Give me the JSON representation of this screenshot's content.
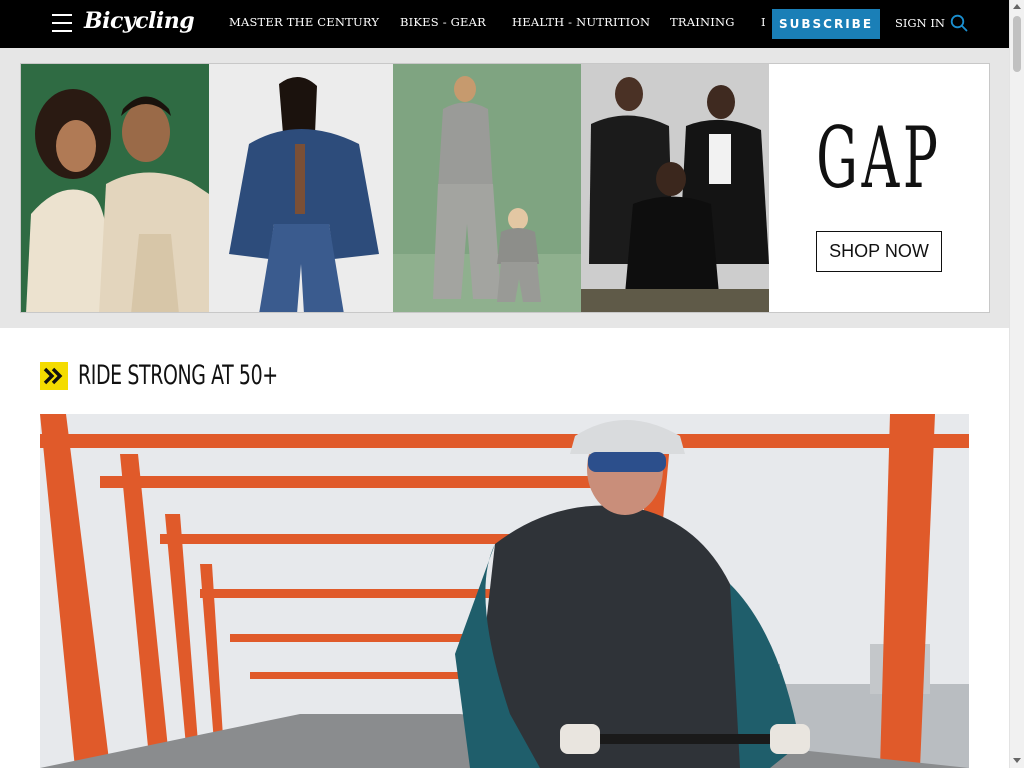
{
  "header": {
    "logo": "Bicycling",
    "nav_items": [
      "MASTER THE CENTURY",
      "BIKES - GEAR",
      "HEALTH - NUTRITION",
      "TRAINING",
      "I"
    ],
    "subscribe_label": "SUBSCRIBE",
    "signin_label": "SIGN IN"
  },
  "ad": {
    "brand": "GAP",
    "cta_label": "SHOP NOW"
  },
  "section": {
    "title": "RIDE STRONG AT 50+"
  },
  "colors": {
    "topbar": "#000000",
    "subscribe": "#1a7fb7",
    "section_accent": "#f4dc00",
    "bridge_orange": "#e05a2a"
  },
  "icons": [
    "menu-icon",
    "search-icon",
    "double-chevron-icon"
  ]
}
